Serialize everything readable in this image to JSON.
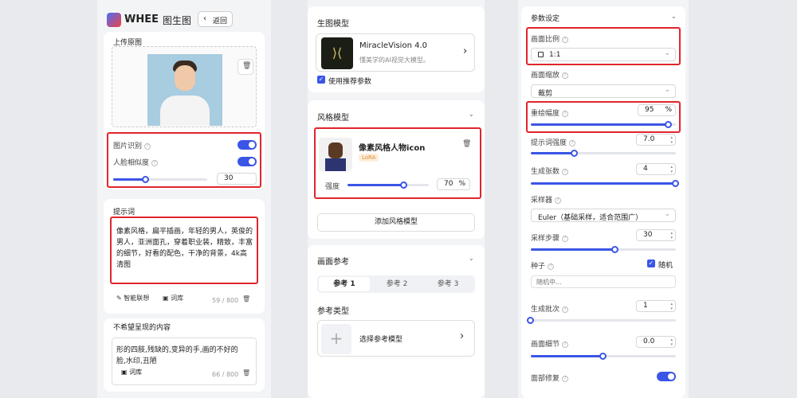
{
  "app": {
    "logo": "WHEE",
    "title": "图生图",
    "back": "返回"
  },
  "upload": {
    "title": "上传原图"
  },
  "recognition": {
    "image_recognition": "图片识别",
    "face_similarity": "人脸相似度",
    "face_value": "30",
    "face_fraction": 0.35
  },
  "prompt": {
    "title": "提示词",
    "text": "像素风格，扁平插画，年轻的男人，英俊的男人，亚洲面孔，穿着职业装，精致，丰富的细节，好看的配色，干净的背景，4k高清图",
    "smart": "智能联想",
    "lexicon": "词库",
    "count": "59 / 800"
  },
  "negative": {
    "title": "不希望呈现的内容",
    "text": "形的四肢,残缺的,变异的手,画的不好的脸,水印,丑陋",
    "lexicon": "词库",
    "count": "66 / 800"
  },
  "model": {
    "title": "生图模型",
    "name": "MiracleVision 4.0",
    "desc": "懂美学的AI视觉大模型。",
    "use_recommended": "使用推荐参数"
  },
  "style": {
    "title": "风格模型",
    "item_name": "像素风格人物icon",
    "tag": "LoRA",
    "strength_label": "强度",
    "strength_value": "70",
    "unit": "%",
    "strength_fraction": 0.7,
    "add": "添加风格模型"
  },
  "reference": {
    "title": "画面参考",
    "tabs": [
      "参考 1",
      "参考 2",
      "参考 3"
    ],
    "type_title": "参考类型",
    "select": "选择参考模型"
  },
  "params": {
    "title": "参数设定",
    "ratio_label": "画面比例",
    "ratio_value": "1:1",
    "scale_label": "画面缩放",
    "scale_value": "裁剪",
    "redraw_label": "重绘幅度",
    "redraw_value": "95",
    "unit": "%",
    "redraw_fraction": 0.95,
    "prompt_strength_label": "提示词强度",
    "prompt_strength_value": "7.0",
    "prompt_strength_fraction": 0.3,
    "count_label": "生成张数",
    "count_value": "4",
    "count_fraction": 1.0,
    "sampler_label": "采样器",
    "sampler_value": "Euler（基础采样，适合范围广）",
    "steps_label": "采样步骤",
    "steps_value": "30",
    "steps_fraction": 0.58,
    "seed_label": "种子",
    "random_label": "随机",
    "seed_placeholder": "随机中...",
    "batch_label": "生成批次",
    "batch_value": "1",
    "batch_fraction": 0.0,
    "detail_label": "画面细节",
    "detail_value": "0.0",
    "detail_fraction": 0.5,
    "face_fix_label": "面部修复"
  }
}
